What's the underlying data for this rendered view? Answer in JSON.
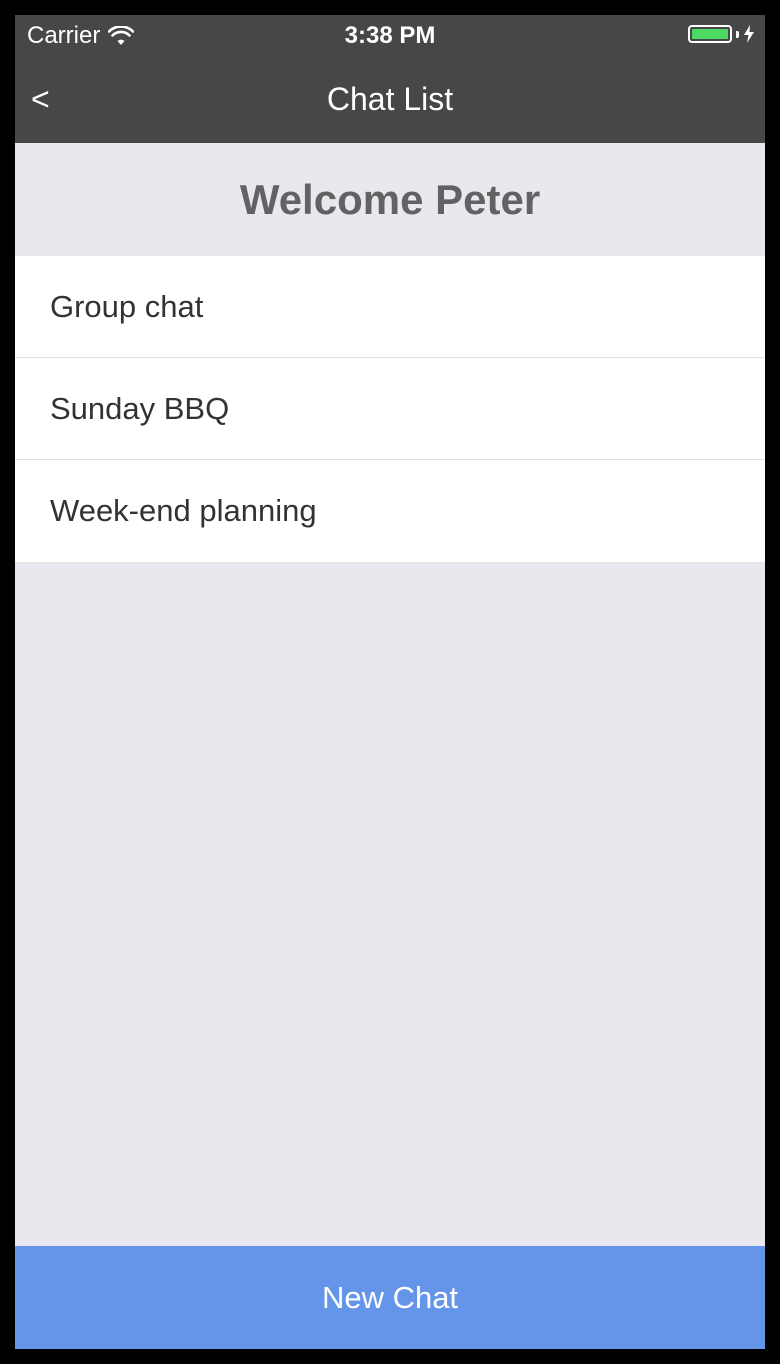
{
  "status_bar": {
    "carrier": "Carrier",
    "time": "3:38 PM",
    "icons": [
      "wifi-icon",
      "battery-icon",
      "charging-bolt-icon"
    ],
    "battery_level": 1.0,
    "battery_color": "#4cd964"
  },
  "nav": {
    "back_label": "<",
    "title": "Chat List",
    "background": "#474747"
  },
  "welcome": {
    "text": "Welcome Peter"
  },
  "chats": [
    {
      "name": "Group chat"
    },
    {
      "name": "Sunday BBQ"
    },
    {
      "name": "Week-end planning"
    }
  ],
  "actions": {
    "new_chat_label": "New Chat",
    "accent": "#6495e8"
  }
}
